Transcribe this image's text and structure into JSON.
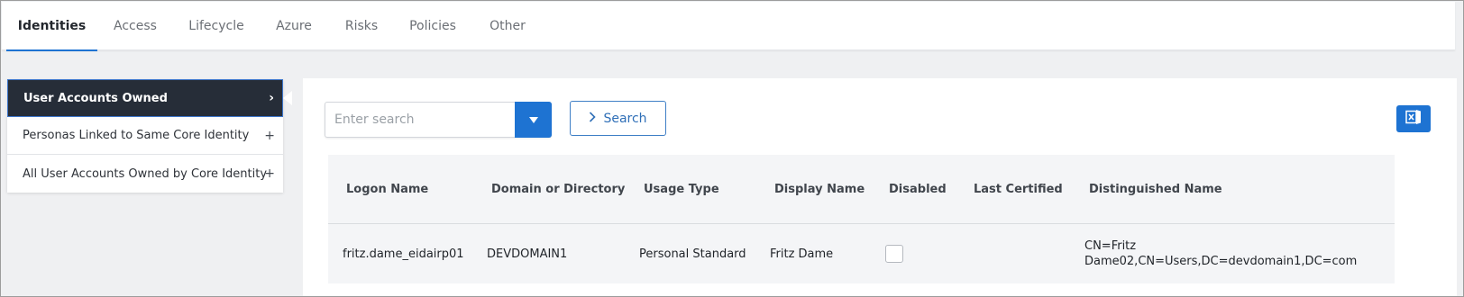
{
  "tabs": [
    {
      "label": "Identities",
      "active": true
    },
    {
      "label": "Access",
      "active": false
    },
    {
      "label": "Lifecycle",
      "active": false
    },
    {
      "label": "Azure",
      "active": false
    },
    {
      "label": "Risks",
      "active": false
    },
    {
      "label": "Policies",
      "active": false
    },
    {
      "label": "Other",
      "active": false
    }
  ],
  "sidebar": {
    "items": [
      {
        "label": "User Accounts Owned",
        "icon": "chevron-right-icon",
        "glyph": "›",
        "active": true
      },
      {
        "label": "Personas Linked to Same Core Identity",
        "icon": "plus-icon",
        "glyph": "+",
        "active": false
      },
      {
        "label": "All User Accounts Owned by Core Identity",
        "icon": "plus-icon",
        "glyph": "+",
        "active": false
      }
    ]
  },
  "search": {
    "placeholder": "Enter search",
    "value": "",
    "button_label": "Search",
    "button_icon": "chevron-right-icon",
    "dropdown_icon": "caret-down-icon"
  },
  "export": {
    "icon": "excel-icon",
    "color": "#1e73d2"
  },
  "table": {
    "columns": [
      "Logon Name",
      "Domain or Directory",
      "Usage Type",
      "Display Name",
      "Disabled",
      "Last Certified",
      "Distinguished Name"
    ],
    "rows": [
      {
        "logon_name": "fritz.dame_eidairp01",
        "domain": "DEVDOMAIN1",
        "usage_type": "Personal Standard",
        "display_name": "Fritz Dame",
        "disabled": false,
        "last_certified": "",
        "distinguished_name": "CN=Fritz Dame02,CN=Users,DC=devdomain1,DC=com"
      }
    ]
  },
  "colors": {
    "accent": "#1e73d2",
    "nav_active_bg": "#262d38",
    "page_bg": "#eff0f2"
  }
}
